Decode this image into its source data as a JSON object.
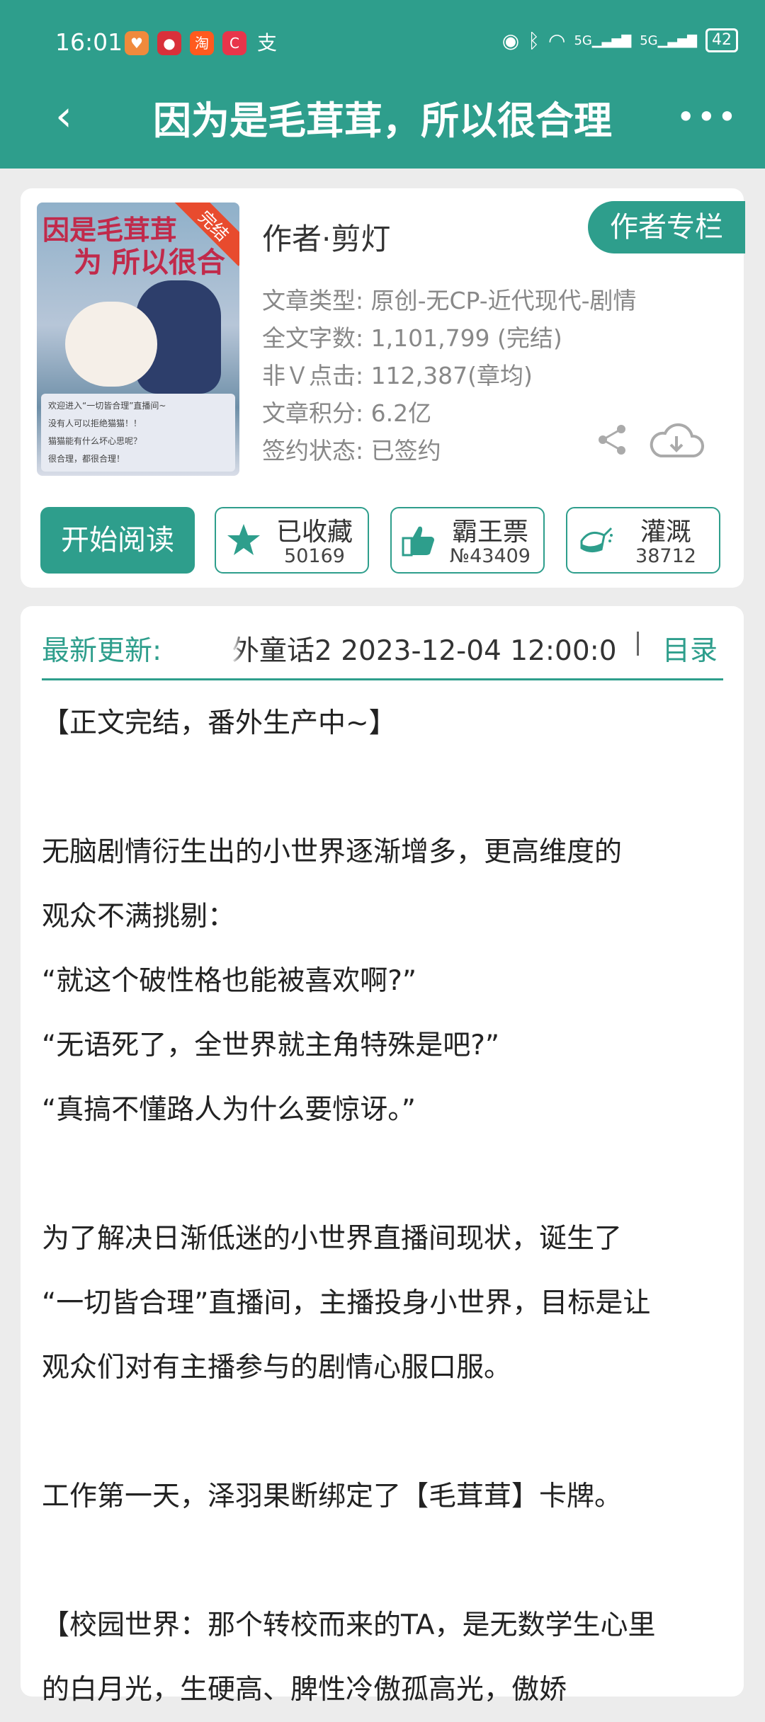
{
  "status_bar": {
    "time": "16:01",
    "battery": "42",
    "net1": "5G",
    "net2": "5G"
  },
  "header": {
    "title": "因为是毛茸茸，所以很合理",
    "more": "•••"
  },
  "book": {
    "cover_title_line1": "因是毛茸茸",
    "cover_title_line2": "为 所以很合",
    "cover_badge": "完结",
    "cover_chat_1": "欢迎进入“一切皆合理”直播间~",
    "cover_chat_2": "没有人可以拒绝猫猫！！",
    "cover_chat_3": "猫猫能有什么坏心思呢？",
    "cover_chat_4": "很合理，都很合理！",
    "author": "作者·剪灯",
    "author_column_label": "作者专栏",
    "info": [
      "文章类型: 原创-无CP-近代现代-剧情",
      "全文字数: 1,101,799 (完结)",
      "非Ｖ点击: 112,387(章均)",
      "文章积分: 6.2亿",
      "签约状态: 已签约"
    ]
  },
  "actions": {
    "read_label": "开始阅读",
    "favorite": {
      "label": "已收藏",
      "count": "50169"
    },
    "ticket": {
      "label": "霸王票",
      "count": "№43409"
    },
    "water": {
      "label": "灌溉",
      "count": "38712"
    }
  },
  "latest": {
    "label": "最新更新:",
    "text": "外童话2  2023-12-04 12:00:0",
    "toc_label": "目录"
  },
  "description": [
    "【正文完结，番外生产中~】",
    "",
    "无脑剧情衍生出的小世界逐渐增多，更高维度的",
    "观众不满挑剔：",
    "“就这个破性格也能被喜欢啊?”",
    "“无语死了，全世界就主角特殊是吧?”",
    "“真搞不懂路人为什么要惊讶。”",
    "",
    "为了解决日渐低迷的小世界直播间现状，诞生了",
    "“一切皆合理”直播间，主播投身小世界，目标是让",
    "观众们对有主播参与的剧情心服口服。",
    "",
    "工作第一天，泽羽果断绑定了【毛茸茸】卡牌。",
    "",
    "【校园世界：那个转校而来的TA，是无数学生心里",
    "的白月光，生硬高、脾性冷傲孤高光，傲娇"
  ],
  "colors": {
    "accent": "#2e9e8c",
    "background": "#ececec"
  }
}
